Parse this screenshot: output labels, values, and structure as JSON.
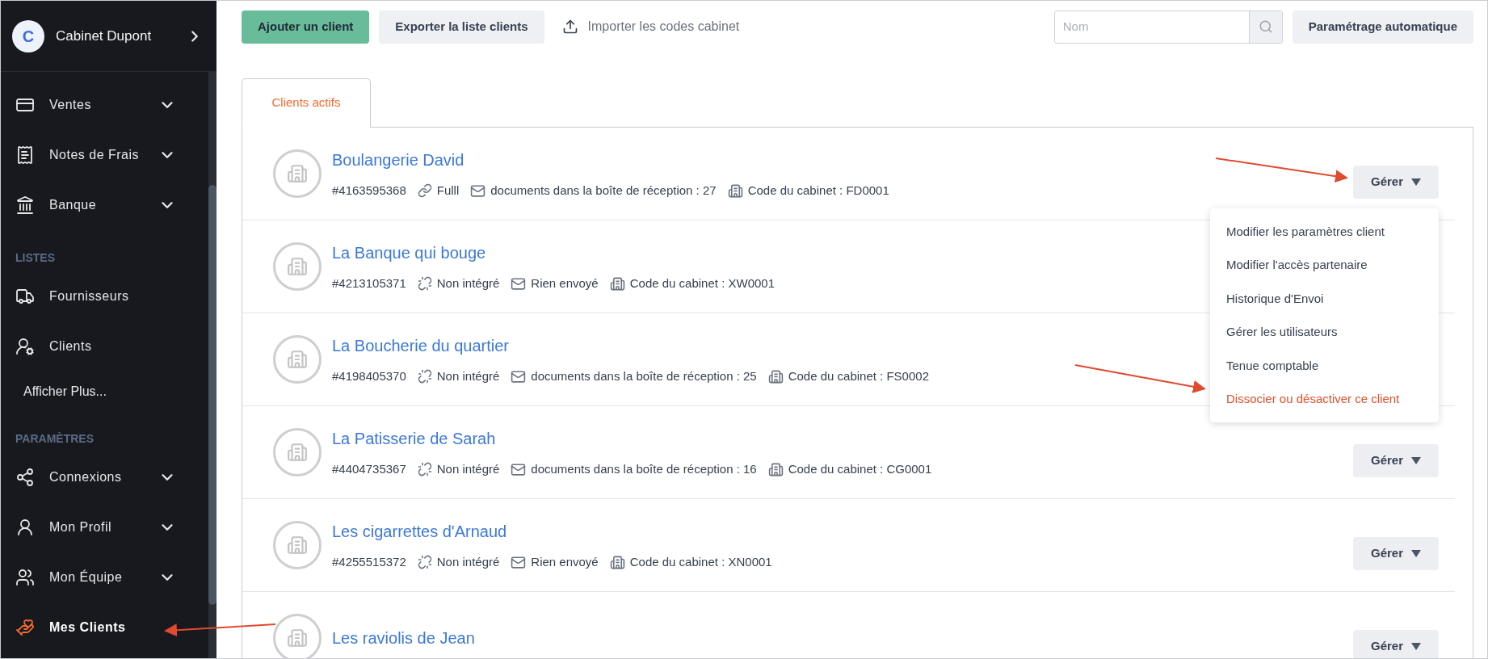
{
  "sidebar": {
    "account": {
      "initial": "C",
      "name": "Cabinet Dupont"
    },
    "items": [
      {
        "kind": "item",
        "label": "Ventes",
        "expandable": true,
        "selected": false
      },
      {
        "kind": "item",
        "label": "Notes de Frais",
        "expandable": true,
        "selected": false
      },
      {
        "kind": "item",
        "label": "Banque",
        "expandable": true,
        "selected": false
      },
      {
        "kind": "section",
        "label": "LISTES"
      },
      {
        "kind": "item",
        "label": "Fournisseurs",
        "expandable": false,
        "selected": false
      },
      {
        "kind": "item",
        "label": "Clients",
        "expandable": false,
        "selected": false
      },
      {
        "kind": "more",
        "label": "Afficher Plus..."
      },
      {
        "kind": "section",
        "label": "PARAMÈTRES"
      },
      {
        "kind": "item",
        "label": "Connexions",
        "expandable": true,
        "selected": false
      },
      {
        "kind": "item",
        "label": "Mon Profil",
        "expandable": true,
        "selected": false
      },
      {
        "kind": "item",
        "label": "Mon Équipe",
        "expandable": true,
        "selected": false
      },
      {
        "kind": "item",
        "label": "Mes Clients",
        "expandable": false,
        "selected": true
      }
    ]
  },
  "toolbar": {
    "add_button": "Ajouter un client",
    "export_button": "Exporter la liste clients",
    "import_link": "Importer les codes cabinet",
    "search": {
      "placeholder": "Nom"
    },
    "auto_button": "Paramétrage automatique"
  },
  "tabs": [
    {
      "label": "Clients actifs",
      "selected": true
    }
  ],
  "clients": [
    {
      "name": "Boulangerie David",
      "meta": [
        {
          "kind": "id",
          "text": "#4163595368"
        },
        {
          "kind": "integration",
          "integrated": true,
          "text": "Fulll"
        },
        {
          "kind": "inbox",
          "text": "documents dans la boîte de réception : 27"
        },
        {
          "kind": "code",
          "text": "Code du cabinet : FD0001"
        }
      ],
      "manage_button": "Gérer",
      "menu": [
        {
          "label": "Modifier les paramètres client",
          "kind": "normal"
        },
        {
          "label": "Modifier l'accès partenaire",
          "kind": "normal"
        },
        {
          "label": "Historique d'Envoi",
          "kind": "normal"
        },
        {
          "label": "Gérer les utilisateurs",
          "kind": "normal"
        },
        {
          "label": "Tenue comptable",
          "kind": "normal"
        },
        {
          "label": "Dissocier ou désactiver ce client",
          "kind": "danger"
        }
      ]
    },
    {
      "name": "La Banque qui bouge",
      "meta": [
        {
          "kind": "id",
          "text": "#4213105371"
        },
        {
          "kind": "integration",
          "integrated": false,
          "text": "Non intégré"
        },
        {
          "kind": "inbox",
          "text": "Rien envoyé"
        },
        {
          "kind": "code",
          "text": "Code du cabinet : XW0001"
        }
      ]
    },
    {
      "name": "La Boucherie du quartier",
      "meta": [
        {
          "kind": "id",
          "text": "#4198405370"
        },
        {
          "kind": "integration",
          "integrated": false,
          "text": "Non intégré"
        },
        {
          "kind": "inbox",
          "text": "documents dans la boîte de réception : 25"
        },
        {
          "kind": "code",
          "text": "Code du cabinet : FS0002"
        }
      ]
    },
    {
      "name": "La Patisserie de Sarah",
      "meta": [
        {
          "kind": "id",
          "text": "#4404735367"
        },
        {
          "kind": "integration",
          "integrated": false,
          "text": "Non intégré"
        },
        {
          "kind": "inbox",
          "text": "documents dans la boîte de réception : 16"
        },
        {
          "kind": "code",
          "text": "Code du cabinet : CG0001"
        }
      ],
      "manage_button": "Gérer"
    },
    {
      "name": "Les cigarrettes d'Arnaud",
      "meta": [
        {
          "kind": "id",
          "text": "#4255515372"
        },
        {
          "kind": "integration",
          "integrated": false,
          "text": "Non intégré"
        },
        {
          "kind": "inbox",
          "text": "Rien envoyé"
        },
        {
          "kind": "code",
          "text": "Code du cabinet : XN0001"
        }
      ],
      "manage_button": "Gérer"
    },
    {
      "name": "Les raviolis de Jean",
      "manage_button": "Gérer"
    }
  ]
}
